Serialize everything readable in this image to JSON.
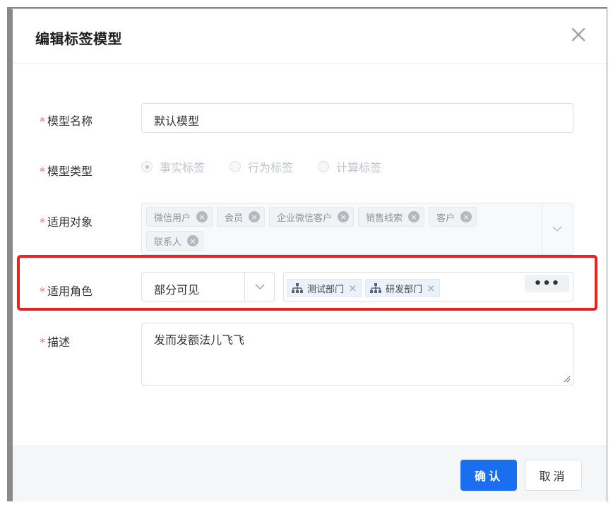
{
  "dialog": {
    "title": "编辑标签模型",
    "close_icon": "close-icon"
  },
  "form": {
    "name": {
      "required_mark": "*",
      "label": "模型名称",
      "value": "默认模型"
    },
    "type": {
      "required_mark": "*",
      "label": "模型类型",
      "options": [
        {
          "label": "事实标签",
          "selected": true
        },
        {
          "label": "行为标签",
          "selected": false
        },
        {
          "label": "计算标签",
          "selected": false
        }
      ]
    },
    "objects": {
      "required_mark": "*",
      "label": "适用对象",
      "tags": [
        "微信用户",
        "会员",
        "企业微信客户",
        "销售线索",
        "客户",
        "联系人"
      ],
      "tag_close_glyph": "×",
      "dropdown_icon": "chevron-down-icon"
    },
    "role": {
      "required_mark": "*",
      "label": "适用角色",
      "visibility": "部分可见",
      "departments": [
        "测试部门",
        "研发部门"
      ],
      "department_icon": "org-tree-icon",
      "tag_close_glyph": "×",
      "more_label": "•••"
    },
    "description": {
      "required_mark": "*",
      "label": "描述",
      "value": "发而发额法儿飞飞"
    }
  },
  "footer": {
    "confirm_label": "确认",
    "cancel_label": "取消"
  },
  "colors": {
    "primary": "#1a6ff0",
    "required": "#f56c6c",
    "highlight": "#e8231e"
  }
}
